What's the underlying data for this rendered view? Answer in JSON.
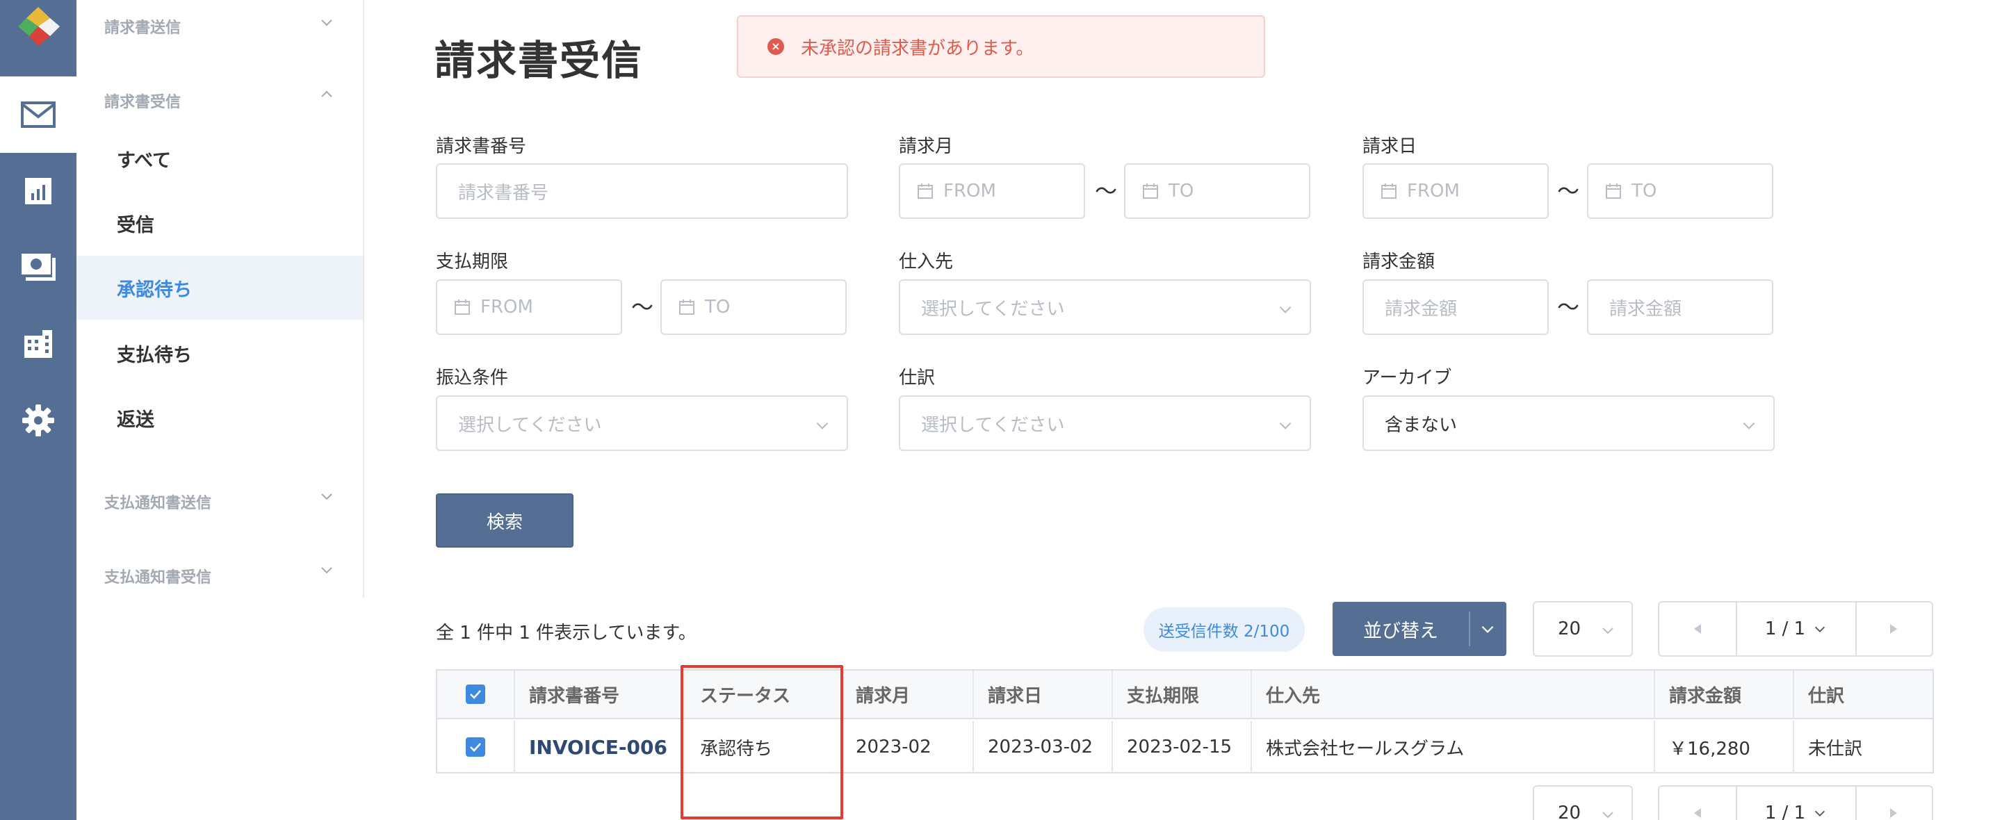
{
  "sidebar": {
    "groups": [
      {
        "label": "請求書送信"
      },
      {
        "label": "請求書受信"
      },
      {
        "label": "支払通知書送信"
      },
      {
        "label": "支払通知書受信"
      }
    ],
    "items": [
      {
        "label": "すべて"
      },
      {
        "label": "受信"
      },
      {
        "label": "承認待ち"
      },
      {
        "label": "支払待ち"
      },
      {
        "label": "返送"
      }
    ],
    "rail_icons": [
      "logo-icon",
      "mail-icon",
      "chart-icon",
      "money-icon",
      "building-icon",
      "gear-icon"
    ]
  },
  "page": {
    "title": "請求書受信",
    "alert": "未承認の請求書があります。"
  },
  "filters": {
    "invoice_no": {
      "label": "請求書番号",
      "placeholder": "請求書番号"
    },
    "invoice_month": {
      "label": "請求月",
      "from": "FROM",
      "to": "TO"
    },
    "invoice_date": {
      "label": "請求日",
      "from": "FROM",
      "to": "TO"
    },
    "due_date": {
      "label": "支払期限",
      "from": "FROM",
      "to": "TO"
    },
    "supplier": {
      "label": "仕入先",
      "placeholder": "選択してください"
    },
    "amount": {
      "label": "請求金額",
      "from": "請求金額",
      "to": "請求金額"
    },
    "transfer": {
      "label": "振込条件",
      "placeholder": "選択してください"
    },
    "journal": {
      "label": "仕訳",
      "placeholder": "選択してください"
    },
    "archive": {
      "label": "アーカイブ",
      "value": "含まない"
    },
    "tilde": "〜",
    "search_button": "検索"
  },
  "results": {
    "count_text": "全 1 件中 1 件表示しています。",
    "badge": "送受信件数 2/100",
    "sort_button": "並び替え",
    "per_page": "20",
    "page_indicator": "1 / 1"
  },
  "table": {
    "columns": [
      "請求書番号",
      "ステータス",
      "請求月",
      "請求日",
      "支払期限",
      "仕入先",
      "請求金額",
      "仕訳"
    ],
    "rows": [
      {
        "invoice_no": "INVOICE-006",
        "status": "承認待ち",
        "month": "2023-02",
        "date": "2023-03-02",
        "due": "2023-02-15",
        "supplier": "株式会社セールスグラム",
        "amount": "￥16,280",
        "journal": "未仕訳"
      }
    ]
  },
  "colors": {
    "rail": "#546f93",
    "accent": "#3d8ae0",
    "alert_text": "#e05b4d",
    "highlight": "#e63b2e"
  }
}
